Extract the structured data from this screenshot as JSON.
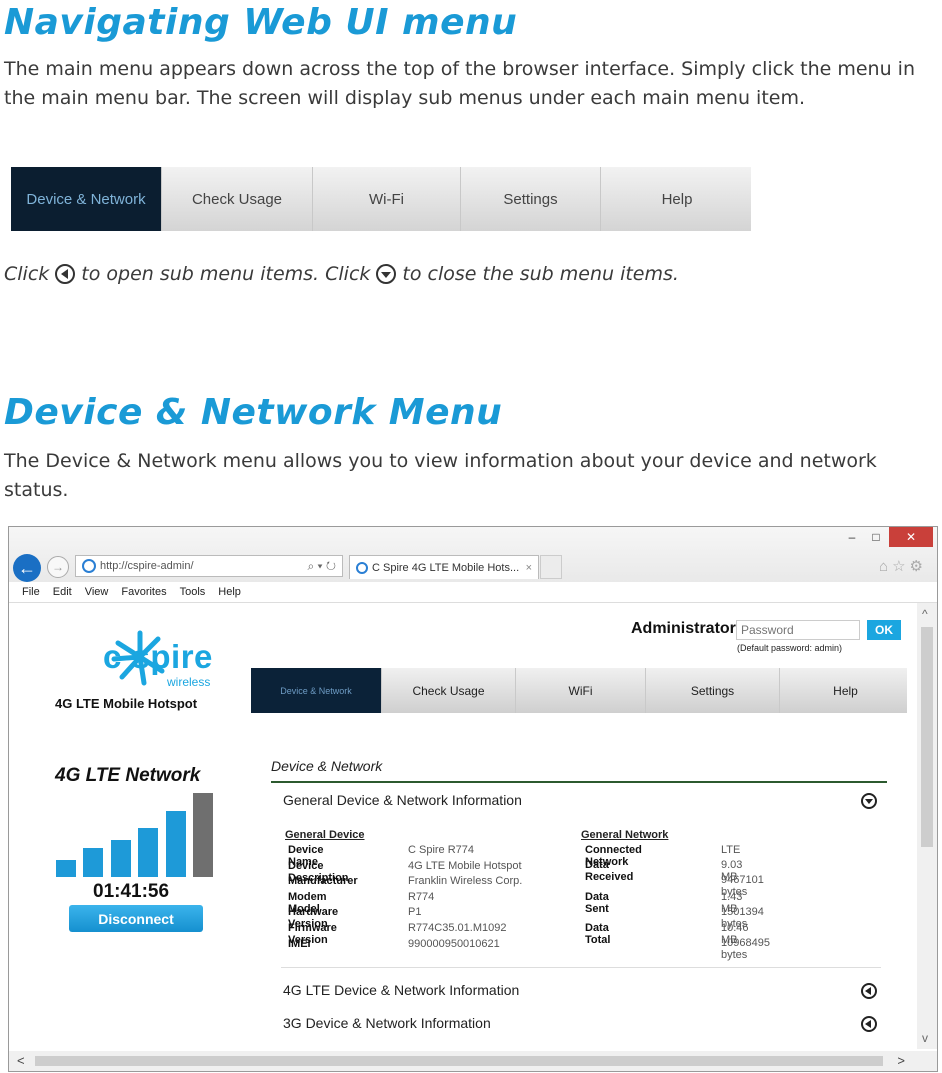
{
  "section1": {
    "title": "Navigating Web UI menu",
    "body": "The main menu appears down across the top of the browser interface. Simply click the menu in the main menu bar. The screen will display sub menus under each main menu item."
  },
  "navdemo": {
    "items": [
      "Device & Network",
      "Check Usage",
      "Wi-Fi",
      "Settings",
      "Help"
    ]
  },
  "click_line": {
    "part1": "Click",
    "part2": "to open sub menu items. Click",
    "part3": "to close the sub menu items."
  },
  "section2": {
    "title": "Device & Network Menu",
    "body": "The Device & Network menu allows you to view information about your device and network status."
  },
  "browser": {
    "url": "http://cspire-admin/",
    "tab_title": "C Spire 4G LTE Mobile Hots...",
    "menus": [
      "File",
      "Edit",
      "View",
      "Favorites",
      "Tools",
      "Help"
    ]
  },
  "page": {
    "brand": "c spire",
    "brand_sub": "wireless",
    "product": "4G LTE Mobile Hotspot",
    "admin_label": "Administrator",
    "password_placeholder": "Password",
    "ok_label": "OK",
    "default_password_hint": "(Default password: admin)",
    "nav": [
      "Device & Network",
      "Check Usage",
      "WiFi",
      "Settings",
      "Help"
    ],
    "network_title": "4G LTE Network",
    "signal_bars": {
      "active": 5,
      "total": 6
    },
    "timer": "01:41:56",
    "disconnect_label": "Disconnect",
    "panel_heading": "Device & Network",
    "sections": [
      "General Device & Network Information",
      "4G LTE Device & Network Information",
      "3G Device & Network Information"
    ],
    "general_device": {
      "heading": "General Device",
      "rows": [
        {
          "label": "Device Name",
          "value": "C Spire R774"
        },
        {
          "label": "Device Description",
          "value": "4G LTE Mobile Hotspot"
        },
        {
          "label": "Manufacturer",
          "value": "Franklin Wireless Corp."
        },
        {
          "label": "Modem Model",
          "value": "R774"
        },
        {
          "label": "Hardware Version",
          "value": "P1"
        },
        {
          "label": "Firmware Version",
          "value": "R774C35.01.M1092"
        },
        {
          "label": "IMEI",
          "value": "990000950010621"
        }
      ]
    },
    "general_network": {
      "heading": "General Network",
      "connected_label": "Connected Network",
      "connected_value": "LTE",
      "received_label": "Data Received",
      "received_mb": "9.03 MB",
      "received_bytes": "9467101 bytes",
      "sent_label": "Data Sent",
      "sent_mb": "1.43 MB",
      "sent_bytes": "1501394 bytes",
      "total_label": "Data Total",
      "total_mb": "10.46 MB",
      "total_bytes": "10968495 bytes"
    }
  }
}
